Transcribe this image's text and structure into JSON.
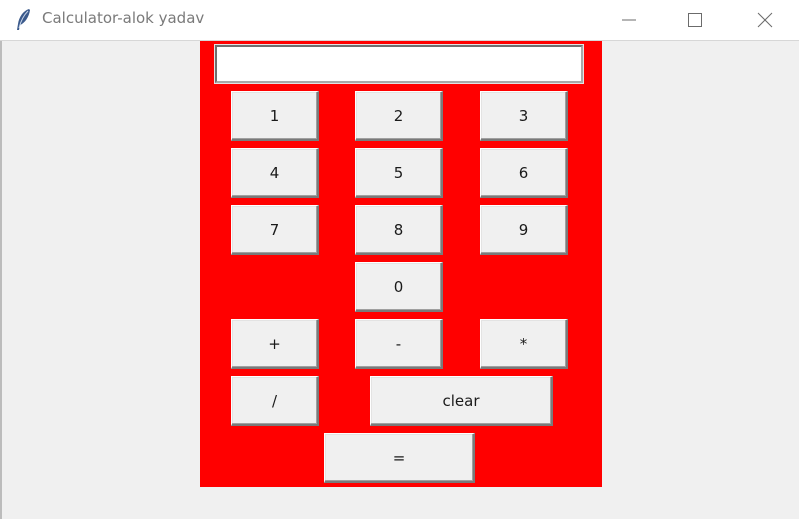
{
  "window": {
    "title": "Calculator-alok yadav"
  },
  "icons": {
    "app": "feather-icon",
    "minimize": "minimize-icon",
    "maximize": "maximize-icon",
    "close": "close-icon"
  },
  "colors": {
    "panel_background": "#ff0000",
    "button_background": "#f0f0f0",
    "window_background": "#f0f0f0"
  },
  "display": {
    "value": ""
  },
  "keys": {
    "k1": "1",
    "k2": "2",
    "k3": "3",
    "k4": "4",
    "k5": "5",
    "k6": "6",
    "k7": "7",
    "k8": "8",
    "k9": "9",
    "k0": "0",
    "plus": "+",
    "minus": "-",
    "multiply": "*",
    "divide": "/",
    "clear": "clear",
    "equals": "="
  }
}
